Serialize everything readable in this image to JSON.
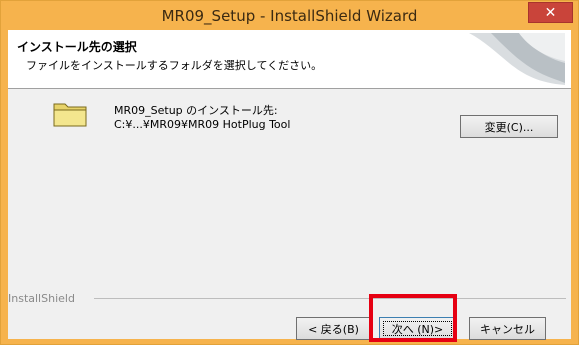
{
  "window": {
    "title": "MR09_Setup - InstallShield Wizard",
    "close_label": "✕"
  },
  "header": {
    "title": "インストール先の選択",
    "subtitle": "ファイルをインストールするフォルダを選択してください。"
  },
  "destination": {
    "label": "MR09_Setup のインストール先:",
    "path": "C:¥...¥MR09¥MR09 HotPlug Tool",
    "change_button": "変更(C)..."
  },
  "footer": {
    "brand": "InstallShield",
    "back_button": "< 戻る(B)",
    "next_button": "次へ (N)>",
    "cancel_button": "キャンセル"
  },
  "colors": {
    "titlebar": "#f6b34d",
    "close": "#c9443a",
    "highlight": "#e60012"
  },
  "icons": {
    "folder": "folder-icon",
    "logo": "installshield-logo"
  }
}
